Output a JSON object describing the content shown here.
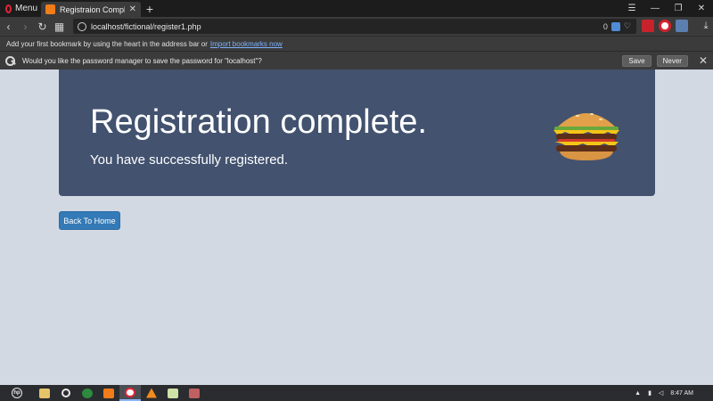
{
  "browser": {
    "menu_label": "Menu",
    "tab_title": "Registraion Complete",
    "new_tab": "+",
    "url": "localhost/fictional/register1.php",
    "blocked_count": "0",
    "bookmark_bar": {
      "text": "Add your first bookmark by using the heart in the address bar or",
      "link": "Import bookmarks now"
    },
    "password_bar": {
      "text": "Would you like the password manager to save the password for \"localhost\"?",
      "save_label": "Save",
      "never_label": "Never"
    }
  },
  "page": {
    "title": "Registration complete.",
    "subtitle": "You have successfully registered.",
    "back_button": "Back To Home"
  },
  "taskbar": {
    "clock": "8:47 AM"
  },
  "colors": {
    "jumbotron_bg": "#42526f",
    "page_bg": "#d3d9e3",
    "button_primary": "#337ab7",
    "opera_red": "#e0263a"
  }
}
